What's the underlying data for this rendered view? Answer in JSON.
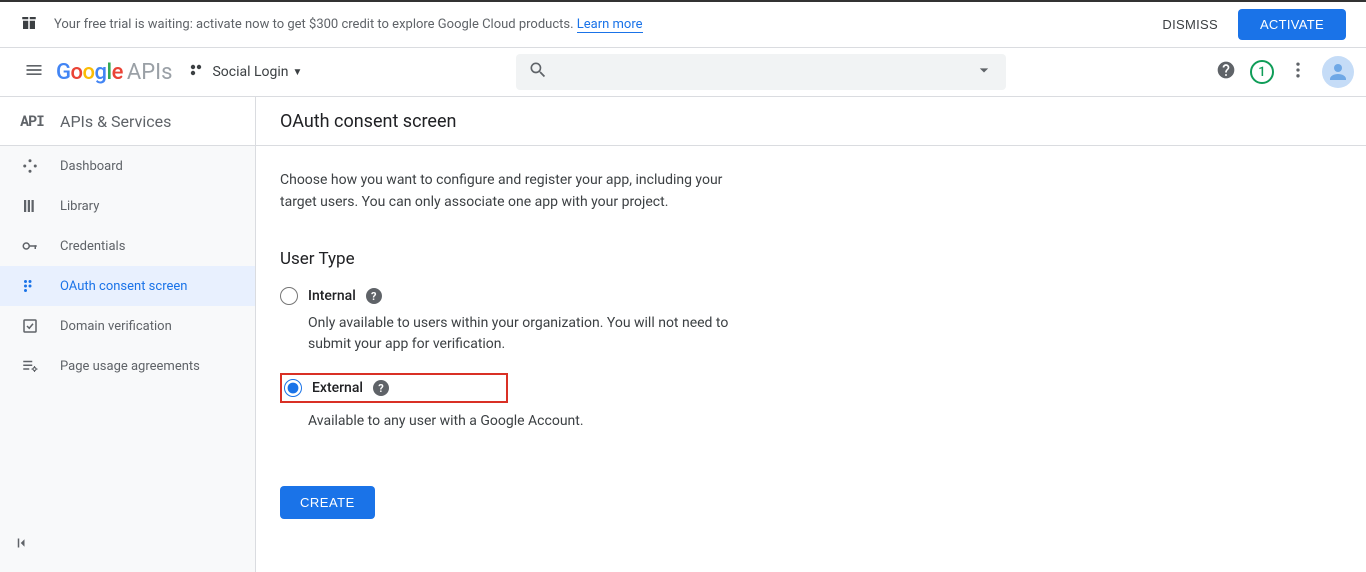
{
  "banner": {
    "text": "Your free trial is waiting: activate now to get $300 credit to explore Google Cloud products. ",
    "learn_more": "Learn more",
    "dismiss": "DISMISS",
    "activate": "ACTIVATE"
  },
  "header": {
    "logo_apis": "APIs",
    "project_name": "Social Login",
    "trial_count": "1"
  },
  "sidebar": {
    "title": "APIs & Services",
    "items": [
      {
        "label": "Dashboard"
      },
      {
        "label": "Library"
      },
      {
        "label": "Credentials"
      },
      {
        "label": "OAuth consent screen"
      },
      {
        "label": "Domain verification"
      },
      {
        "label": "Page usage agreements"
      }
    ]
  },
  "main": {
    "title": "OAuth consent screen",
    "description": "Choose how you want to configure and register your app, including your target users. You can only associate one app with your project.",
    "section": "User Type",
    "options": {
      "internal": {
        "label": "Internal",
        "desc": "Only available to users within your organization. You will not need to submit your app for verification."
      },
      "external": {
        "label": "External",
        "desc": "Available to any user with a Google Account."
      }
    },
    "create": "CREATE"
  }
}
